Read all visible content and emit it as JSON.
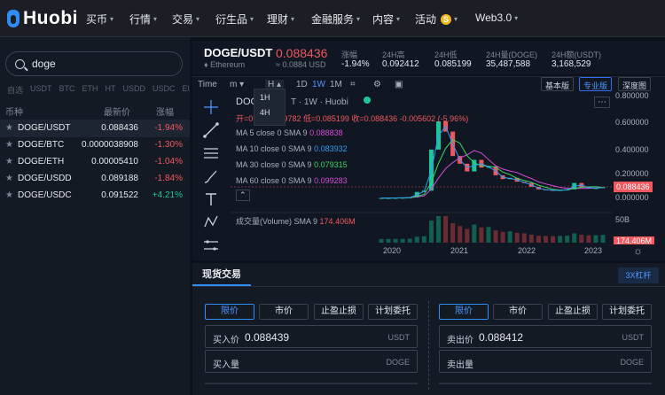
{
  "brand": {
    "name": "Huobi"
  },
  "nav": [
    {
      "label": "买币",
      "caret": true
    },
    {
      "label": "行情",
      "caret": true
    },
    {
      "label": "交易",
      "caret": true
    },
    {
      "label": "衍生品",
      "caret": true
    },
    {
      "label": "理财",
      "caret": true
    },
    {
      "label": "金融服务",
      "caret": true
    },
    {
      "label": "内容",
      "caret": true
    },
    {
      "label": "活动",
      "caret": true,
      "badge": "S"
    },
    {
      "label": "Web3.0",
      "caret": true
    }
  ],
  "search": {
    "value": "doge"
  },
  "quote_tabs": [
    "自选",
    "USDT",
    "BTC",
    "ETH",
    "HT",
    "USDD",
    "USDC",
    "EURO"
  ],
  "list_header": {
    "symbol": "币种",
    "price": "最新价",
    "change": "涨幅"
  },
  "pairs": [
    {
      "symbol": "DOGE/USDT",
      "price": "0.088436",
      "change": "-1.94%",
      "dir": "neg"
    },
    {
      "symbol": "DOGE/BTC",
      "price": "0.0000038908",
      "change": "-1.30%",
      "dir": "neg"
    },
    {
      "symbol": "DOGE/ETH",
      "price": "0.00005410",
      "change": "-1.04%",
      "dir": "neg"
    },
    {
      "symbol": "DOGE/USDD",
      "price": "0.089188",
      "change": "-1.84%",
      "dir": "neg"
    },
    {
      "symbol": "DOGE/USDC",
      "price": "0.091522",
      "change": "+4.21%",
      "dir": "pos"
    }
  ],
  "ticker": {
    "pair": "DOGE/USDT",
    "chain": "Ethereum",
    "last": "0.088436",
    "last_usd": "≈ 0.0884 USD",
    "change_label": "涨幅",
    "change": "-1.94%",
    "high_label": "24H高",
    "high": "0.092412",
    "low_label": "24H低",
    "low": "0.085199",
    "vol_label": "24H量(DOGE)",
    "vol": "35,487,588",
    "amt_label": "24H额(USDT)",
    "amt": "3,168,529"
  },
  "chart_tools": {
    "time": "Time",
    "m": "m",
    "h": "H",
    "d": "1D",
    "w": "1W",
    "mo": "1M",
    "basic": "基本版",
    "pro": "专业版",
    "depth": "深度图"
  },
  "interval_popup": [
    "1H",
    "4H"
  ],
  "chart_header": {
    "title": "DOG",
    "subtitle": "T · 1W · Huobi",
    "ohlc": "开=0     高=0.099782  低=0.085199  收=0.088436  -0.005602 (-5.96%)"
  },
  "chart_data": {
    "type": "line",
    "series": [
      {
        "name": "MA 5 close 0 SMA 9",
        "value": "0.088838",
        "color": "#d34bd9"
      },
      {
        "name": "MA 10 close 0 SMA 9",
        "value": "0.083932",
        "color": "#2f9cf2"
      },
      {
        "name": "MA 30 close 0 SMA 9",
        "value": "0.079315",
        "color": "#3cd463"
      },
      {
        "name": "MA 60 close 0 SMA 9",
        "value": "0.099283",
        "color": "#d34bd9"
      }
    ],
    "volume": {
      "name": "成交量(Volume) SMA 9",
      "value": "174.406M",
      "ticks": [
        "50B",
        "174.406M"
      ]
    },
    "price_line": "0.088436",
    "ylim": [
      0,
      0.8
    ],
    "yticks": [
      "0.800000",
      "0.600000",
      "0.400000",
      "0.200000",
      "0.000000"
    ],
    "xticks": [
      "2020",
      "2021",
      "2022",
      "2023"
    ],
    "weekly_close": [
      0.003,
      0.003,
      0.004,
      0.005,
      0.008,
      0.05,
      0.06,
      0.38,
      0.6,
      0.52,
      0.33,
      0.27,
      0.21,
      0.3,
      0.24,
      0.25,
      0.18,
      0.15,
      0.16,
      0.13,
      0.12,
      0.09,
      0.07,
      0.065,
      0.06,
      0.065,
      0.07,
      0.12,
      0.09,
      0.078,
      0.08,
      0.088
    ]
  },
  "trade": {
    "tab": "现货交易",
    "leverage": "3X杠杆",
    "order_types": [
      "限价",
      "市价",
      "止盈止损",
      "计划委托"
    ],
    "buy": {
      "price_label": "买入价",
      "price": "0.088439",
      "unit": "USDT",
      "qty_label": "买入量",
      "qty_unit": "DOGE"
    },
    "sell": {
      "price_label": "卖出价",
      "price": "0.088412",
      "unit": "USDT",
      "qty_label": "卖出量",
      "qty_unit": "DOGE"
    }
  },
  "colors": {
    "accent": "#2e8ef5",
    "up": "#1fc59a",
    "down": "#f0575e"
  }
}
